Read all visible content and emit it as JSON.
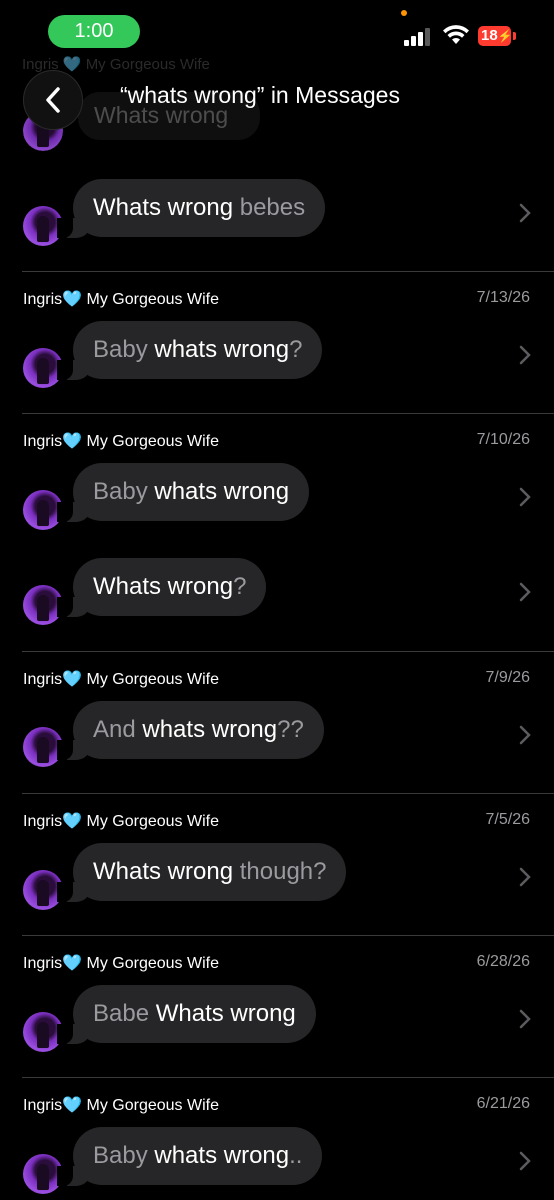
{
  "status_bar": {
    "time": "1:00",
    "battery": "18"
  },
  "nav": {
    "title": "“whats wrong” in Messages"
  },
  "ghost": {
    "header": "Ingris 🩵 My Gorgeous Wife",
    "text": "Whats wrong"
  },
  "results": [
    {
      "header": null,
      "date": null,
      "before": "",
      "match": "Whats wrong",
      "after": " bebes"
    },
    {
      "header": "Ingris🩵 My Gorgeous Wife",
      "date": "7/13/26",
      "before": "Baby ",
      "match": "whats wrong",
      "after": "?"
    },
    {
      "header": "Ingris🩵 My Gorgeous Wife",
      "date": "7/10/26",
      "before": "Baby ",
      "match": "whats wrong",
      "after": ""
    },
    {
      "header": null,
      "date": null,
      "before": "",
      "match": "Whats wrong",
      "after": "?"
    },
    {
      "header": "Ingris🩵 My Gorgeous Wife",
      "date": "7/9/26",
      "before": "And ",
      "match": "whats wrong",
      "after": "??"
    },
    {
      "header": "Ingris🩵 My Gorgeous Wife",
      "date": "7/5/26",
      "before": "",
      "match": "Whats wrong",
      "after": " though?"
    },
    {
      "header": "Ingris🩵 My Gorgeous Wife",
      "date": "6/28/26",
      "before": "Babe ",
      "match": "Whats wrong",
      "after": ""
    },
    {
      "header": "Ingris🩵 My Gorgeous Wife",
      "date": "6/21/26",
      "before": "Baby ",
      "match": "whats wrong",
      "after": ".."
    }
  ],
  "colors": {
    "bubble": "#262628",
    "time_pill": "#34c759",
    "battery": "#ff3b30",
    "dim_text": "#9a9a9f"
  }
}
